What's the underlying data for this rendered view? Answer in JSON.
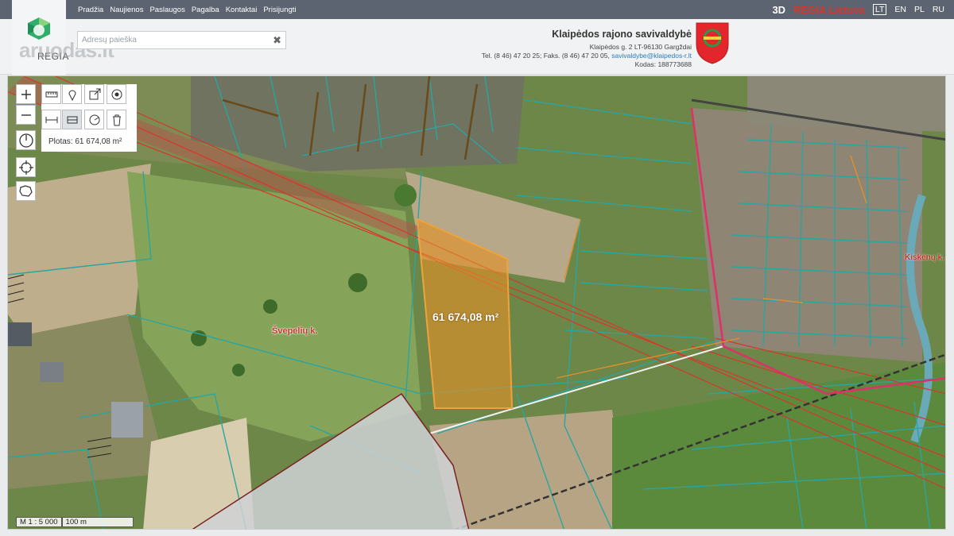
{
  "nav": {
    "items": [
      "Pradžia",
      "Naujienos",
      "Paslaugos",
      "Pagalba",
      "Kontaktai",
      "Prisijungti"
    ]
  },
  "top_right": {
    "btn_3d": "3D",
    "regia_label": "REGIA Lietuva",
    "languages": [
      "LT",
      "EN",
      "PL",
      "RU"
    ],
    "active_language": "LT"
  },
  "header": {
    "logo_text": "REGIA",
    "watermark": "aruodas.lt",
    "search_placeholder": "Adresų paieška",
    "municipality": {
      "name": "Klaipėdos rajono savivaldybė",
      "address": "Klaipėdos g. 2 LT-96130 Gargždai",
      "phone": "Tel. (8 46) 47 20 25; Faks. (8 46) 47 20 05,",
      "email": "savivaldybe@klaipedos-r.lt",
      "code": "Kodas: 188773688"
    }
  },
  "map": {
    "area_readout": "Plotas: 61 674,08 m²",
    "selected_area_label": "61 674,08 m²",
    "village_label": "Švepelių k.",
    "kiskeniu_label": "Kiskėnų k.",
    "scale": "M 1 : 5 000",
    "scale_distance": "100 m"
  },
  "colors": {
    "topbar": "#5b6470",
    "selection_fill": "#e0902a",
    "parcel_line": "#2aa5a0",
    "boundary": "#e0306a",
    "accent_red": "#d9362b"
  }
}
